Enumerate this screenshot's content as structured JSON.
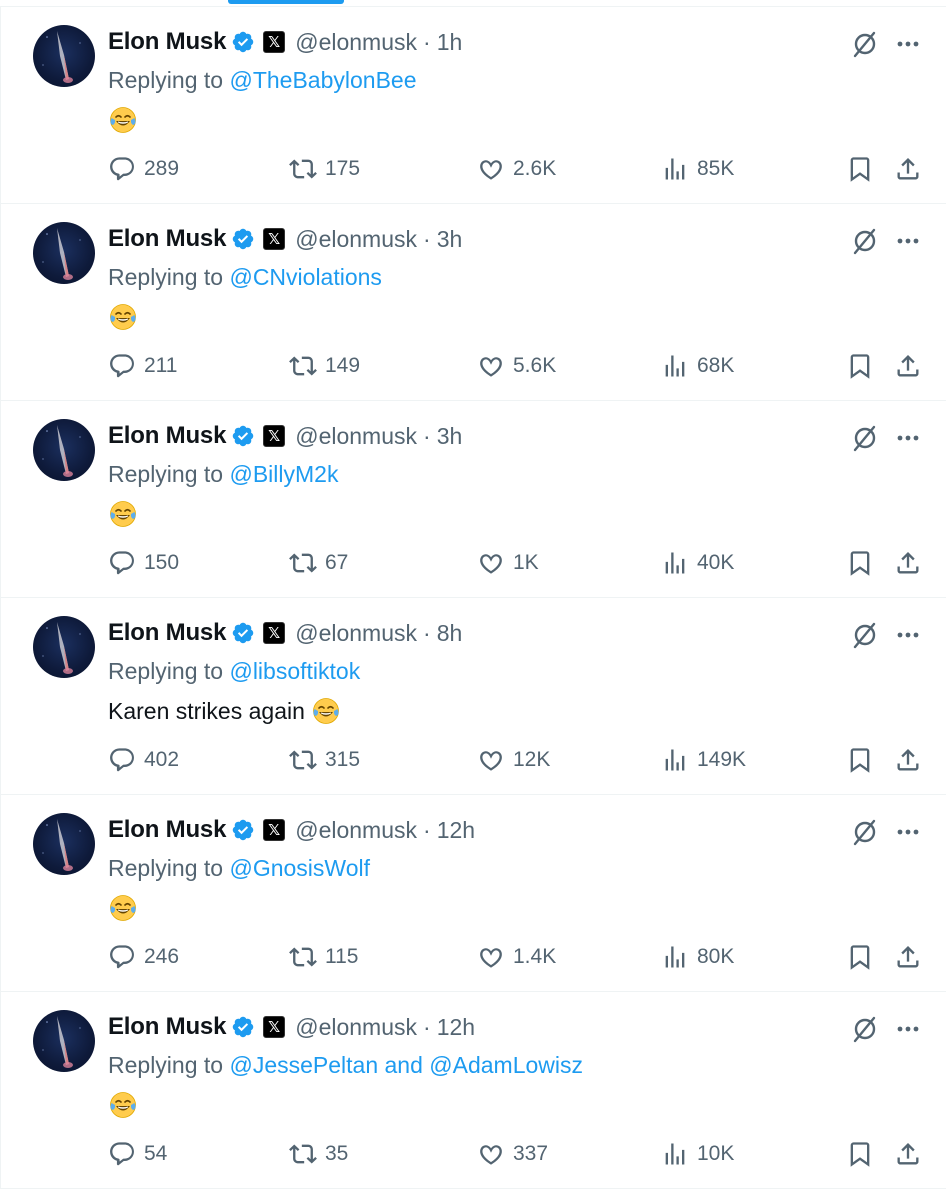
{
  "colors": {
    "accent": "#1d9bf0",
    "text": "#0f1419",
    "secondary": "#536471",
    "border": "#eff3f4"
  },
  "tweets": [
    {
      "name": "Elon Musk",
      "handle": "@elonmusk",
      "time": "1h",
      "replying_prefix": "Replying to",
      "reply_to": "@TheBabylonBee",
      "reply_to_2": "",
      "text": "",
      "emoji": "face-with-tears-of-joy",
      "replies": "289",
      "retweets": "175",
      "likes": "2.6K",
      "views": "85K"
    },
    {
      "name": "Elon Musk",
      "handle": "@elonmusk",
      "time": "3h",
      "replying_prefix": "Replying to",
      "reply_to": "@CNviolations",
      "reply_to_2": "",
      "text": "",
      "emoji": "face-with-tears-of-joy",
      "replies": "211",
      "retweets": "149",
      "likes": "5.6K",
      "views": "68K"
    },
    {
      "name": "Elon Musk",
      "handle": "@elonmusk",
      "time": "3h",
      "replying_prefix": "Replying to",
      "reply_to": "@BillyM2k",
      "reply_to_2": "",
      "text": "",
      "emoji": "face-with-tears-of-joy",
      "replies": "150",
      "retweets": "67",
      "likes": "1K",
      "views": "40K"
    },
    {
      "name": "Elon Musk",
      "handle": "@elonmusk",
      "time": "8h",
      "replying_prefix": "Replying to",
      "reply_to": "@libsoftiktok",
      "reply_to_2": "",
      "text": "Karen strikes again",
      "emoji": "face-with-tears-of-joy",
      "replies": "402",
      "retweets": "315",
      "likes": "12K",
      "views": "149K"
    },
    {
      "name": "Elon Musk",
      "handle": "@elonmusk",
      "time": "12h",
      "replying_prefix": "Replying to",
      "reply_to": "@GnosisWolf",
      "reply_to_2": "",
      "text": "",
      "emoji": "face-with-tears-of-joy",
      "replies": "246",
      "retweets": "115",
      "likes": "1.4K",
      "views": "80K"
    },
    {
      "name": "Elon Musk",
      "handle": "@elonmusk",
      "time": "12h",
      "replying_prefix": "Replying to",
      "reply_to": "@JessePeltan",
      "reply_to_2": "@AdamLowisz",
      "text": "",
      "emoji": "face-with-tears-of-joy",
      "replies": "54",
      "retweets": "35",
      "likes": "337",
      "views": "10K"
    }
  ]
}
